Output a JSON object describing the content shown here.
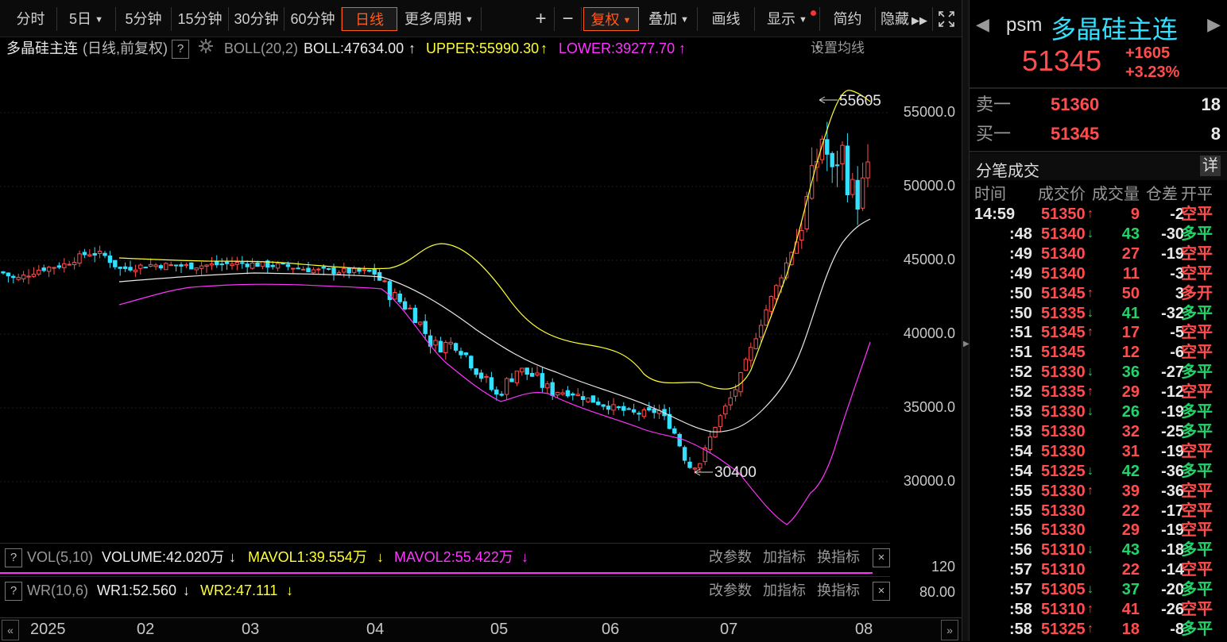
{
  "toolbar": {
    "buttons": [
      "分时",
      "5日",
      "5分钟",
      "15分钟",
      "30分钟",
      "60分钟",
      "日线",
      "更多周期"
    ],
    "zoom_in": "+",
    "zoom_out": "−",
    "fuquan": "复权",
    "overlay": "叠加",
    "draw": "画线",
    "display": "显示",
    "simple": "简约",
    "hide": "隐藏"
  },
  "infobar": {
    "name": "多晶硅主连",
    "mode": "(日线,前复权)",
    "help": "?",
    "indicator": "BOLL(20,2)",
    "boll": "BOLL:47634.00",
    "upper": "UPPER:55990.30",
    "lower": "LOWER:39277.70",
    "settings": "设置均线"
  },
  "price_axis": [
    "55000.0",
    "50000.0",
    "45000.0",
    "40000.0",
    "35000.0",
    "30000.0"
  ],
  "annotations": {
    "high": "55605",
    "low": "30400"
  },
  "vol_panel": {
    "help": "?",
    "name": "VOL(5,10)",
    "volume": "VOLUME:42.020万",
    "mavol1": "MAVOL1:39.554万",
    "mavol2": "MAVOL2:55.422万",
    "change_params": "改参数",
    "add_indicator": "加指标",
    "switch_indicator": "换指标",
    "close": "×",
    "axis": "12",
    "axis_unit": "0"
  },
  "wr_panel": {
    "help": "?",
    "name": "WR(10,6)",
    "wr1": "WR1:52.560",
    "wr2": "WR2:47.111",
    "change_params": "改参数",
    "add_indicator": "加指标",
    "switch_indicator": "换指标",
    "close": "×",
    "axis": "80.00"
  },
  "xaxis": {
    "labels": [
      "2025",
      "02",
      "03",
      "04",
      "05",
      "06",
      "07",
      "08"
    ]
  },
  "quote": {
    "code": "psm",
    "name": "多晶硅主连",
    "price": "51345",
    "change": "+1605",
    "change_pct": "+3.23%",
    "ask_label": "卖一",
    "ask_price": "51360",
    "ask_vol": "18",
    "bid_label": "买一",
    "bid_price": "51345",
    "bid_vol": "8"
  },
  "trades": {
    "title": "分笔成交",
    "detail": "详",
    "headers": [
      "时间",
      "成交价",
      "成交量",
      "仓差",
      "开平"
    ],
    "rows": [
      {
        "time": "14:59",
        "price": "51350",
        "dir": "up",
        "vol": "9",
        "oi": "-2",
        "type": "空平"
      },
      {
        "time": ":48",
        "price": "51340",
        "dir": "down",
        "vol": "43",
        "oi": "-30",
        "type": "多平"
      },
      {
        "time": ":49",
        "price": "51340",
        "dir": "",
        "vol": "27",
        "oi": "-19",
        "type": "空平"
      },
      {
        "time": ":49",
        "price": "51340",
        "dir": "",
        "vol": "11",
        "oi": "-3",
        "type": "空平"
      },
      {
        "time": ":50",
        "price": "51345",
        "dir": "up",
        "vol": "50",
        "oi": "3",
        "type": "多开"
      },
      {
        "time": ":50",
        "price": "51335",
        "dir": "down",
        "vol": "41",
        "oi": "-32",
        "type": "多平"
      },
      {
        "time": ":51",
        "price": "51345",
        "dir": "up",
        "vol": "17",
        "oi": "-5",
        "type": "空平"
      },
      {
        "time": ":51",
        "price": "51345",
        "dir": "",
        "vol": "12",
        "oi": "-6",
        "type": "空平"
      },
      {
        "time": ":52",
        "price": "51330",
        "dir": "down",
        "vol": "36",
        "oi": "-27",
        "type": "多平"
      },
      {
        "time": ":52",
        "price": "51335",
        "dir": "up",
        "vol": "29",
        "oi": "-12",
        "type": "空平"
      },
      {
        "time": ":53",
        "price": "51330",
        "dir": "down",
        "vol": "26",
        "oi": "-19",
        "type": "多平"
      },
      {
        "time": ":53",
        "price": "51330",
        "dir": "",
        "vol": "32",
        "oi": "-25",
        "type": "多平"
      },
      {
        "time": ":54",
        "price": "51330",
        "dir": "",
        "vol": "31",
        "oi": "-19",
        "type": "空平"
      },
      {
        "time": ":54",
        "price": "51325",
        "dir": "down",
        "vol": "42",
        "oi": "-36",
        "type": "多平"
      },
      {
        "time": ":55",
        "price": "51330",
        "dir": "up",
        "vol": "39",
        "oi": "-36",
        "type": "空平"
      },
      {
        "time": ":55",
        "price": "51330",
        "dir": "",
        "vol": "22",
        "oi": "-17",
        "type": "空平"
      },
      {
        "time": ":56",
        "price": "51330",
        "dir": "",
        "vol": "29",
        "oi": "-19",
        "type": "空平"
      },
      {
        "time": ":56",
        "price": "51310",
        "dir": "down",
        "vol": "43",
        "oi": "-18",
        "type": "多平"
      },
      {
        "time": ":57",
        "price": "51310",
        "dir": "",
        "vol": "22",
        "oi": "-14",
        "type": "空平"
      },
      {
        "time": ":57",
        "price": "51305",
        "dir": "down",
        "vol": "37",
        "oi": "-20",
        "type": "多平"
      },
      {
        "time": ":58",
        "price": "51310",
        "dir": "up",
        "vol": "41",
        "oi": "-26",
        "type": "空平"
      },
      {
        "time": ":58",
        "price": "51325",
        "dir": "up",
        "vol": "18",
        "oi": "-8",
        "type": "多平"
      }
    ]
  },
  "colors": {
    "up": "#ff4d4d",
    "down": "#22d26a",
    "cyan": "#33e0ff",
    "upper": "#ffff33",
    "lower": "#ff33ff",
    "mid": "#e8e8e8",
    "accent": "#ff5a1a"
  }
}
